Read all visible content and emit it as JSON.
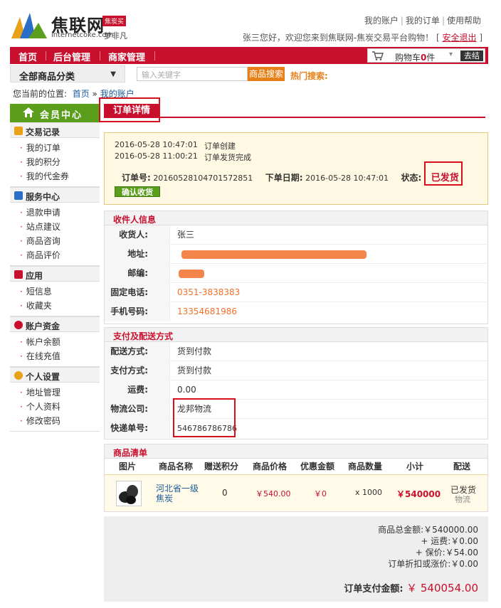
{
  "header": {
    "site_name": "焦联网",
    "site_url": "internetcoke.com",
    "badge": "焦炭买",
    "slogan": "梦非凡",
    "links": [
      "我的账户",
      "我的订单",
      "使用帮助"
    ],
    "welcome": "张三您好，欢迎您来到焦联网-焦炭交易平台购物！",
    "logout": "安全退出"
  },
  "nav": {
    "items": [
      "首页",
      "后台管理",
      "商家管理"
    ],
    "cart_label": "购物车",
    "cart_count": "0",
    "cart_unit": "件",
    "cart_go": "去结"
  },
  "search": {
    "category": "全部商品分类",
    "placeholder": "输入关键字",
    "button": "商品搜索",
    "hot_label": "热门搜索:"
  },
  "breadcrumb": {
    "prefix": "您当前的位置:",
    "home": "首页",
    "sep": "»",
    "current": "我的账户"
  },
  "sidebar": {
    "title": "会员中心",
    "groups": [
      {
        "title": "交易记录",
        "items": [
          "我的订单",
          "我的积分",
          "我的代金券"
        ]
      },
      {
        "title": "服务中心",
        "items": [
          "退款申请",
          "站点建议",
          "商品咨询",
          "商品评价"
        ]
      },
      {
        "title": "应用",
        "items": [
          "短信息",
          "收藏夹"
        ]
      },
      {
        "title": "账户资金",
        "items": [
          "帐户余额",
          "在线充值"
        ]
      },
      {
        "title": "个人设置",
        "items": [
          "地址管理",
          "个人资料",
          "修改密码"
        ]
      }
    ]
  },
  "order": {
    "tab": "订单详情",
    "log": [
      {
        "time": "2016-05-28 10:47:01",
        "event": "订单创建"
      },
      {
        "time": "2016-05-28 11:00:21",
        "event": "订单发货完成"
      }
    ],
    "no_label": "订单号:",
    "no": "20160528104701572851",
    "date_label": "下单日期:",
    "date": "2016-05-28 10:47:01",
    "status_label": "状态:",
    "status": "已发货",
    "confirm_button": "确认收货"
  },
  "receiver": {
    "title": "收件人信息",
    "name_label": "收货人:",
    "name": "张三",
    "address_label": "地址:",
    "zip_label": "邮编:",
    "phone_label": "固定电话:",
    "phone_partial": "0351-3838383",
    "mobile_label": "手机号码:",
    "mobile_partial": "13354681986"
  },
  "delivery": {
    "title": "支付及配送方式",
    "ship_label": "配送方式:",
    "ship": "货到付款",
    "pay_label": "支付方式:",
    "pay": "货到付款",
    "fee_label": "运费:",
    "fee": "0.00",
    "company_label": "物流公司:",
    "company": "龙邦物流",
    "tracking_label": "快递单号:",
    "tracking": "546786786786"
  },
  "goods": {
    "title": "商品清单",
    "headers": [
      "图片",
      "商品名称",
      "赠送积分",
      "商品价格",
      "优惠金额",
      "商品数量",
      "小计",
      "配送"
    ],
    "rows": [
      {
        "name": "河北省一级焦炭",
        "points": "0",
        "price": "￥540.00",
        "discount": "￥0",
        "qty": "x 1000",
        "subtotal": "￥540000",
        "ship_status": "已发货",
        "ship_link": "物流"
      }
    ]
  },
  "totals": {
    "goods_total": "商品总金额:￥540000.00",
    "freight": "+ 运费:￥0.00",
    "insurance": "+ 保价:￥54.00",
    "adjust": "订单折扣或涨价:￥0.00",
    "pay_label": "订单支付金额:",
    "pay_amount": "￥ 540054.00"
  },
  "colors": {
    "brand_red": "#c8102e",
    "green": "#5a9e1c",
    "orange": "#e8801a"
  }
}
